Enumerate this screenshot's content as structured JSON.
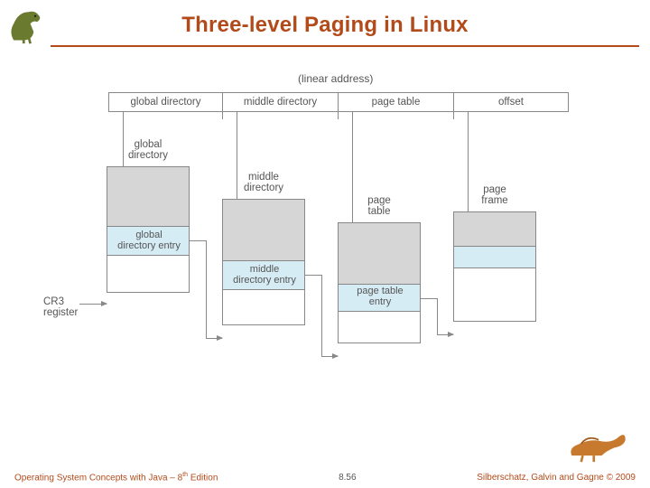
{
  "header": {
    "title": "Three-level Paging in Linux"
  },
  "diagram": {
    "caption": "(linear address)",
    "fields": [
      {
        "label": "global directory"
      },
      {
        "label": "middle directory"
      },
      {
        "label": "page table"
      },
      {
        "label": "offset"
      }
    ],
    "tables": [
      {
        "title": "global\ndirectory",
        "entry": "global\ndirectory entry"
      },
      {
        "title": "middle\ndirectory",
        "entry": "middle\ndirectory entry"
      },
      {
        "title": "page\ntable",
        "entry": "page table\nentry"
      },
      {
        "title": "page\nframe",
        "entry": ""
      }
    ],
    "cr3": "CR3\nregister"
  },
  "footer": {
    "left_prefix": "Operating System Concepts  with Java – 8",
    "left_suffix": " Edition",
    "left_sup": "th",
    "center": "8.56",
    "right": "Silberschatz, Galvin and Gagne © 2009"
  }
}
